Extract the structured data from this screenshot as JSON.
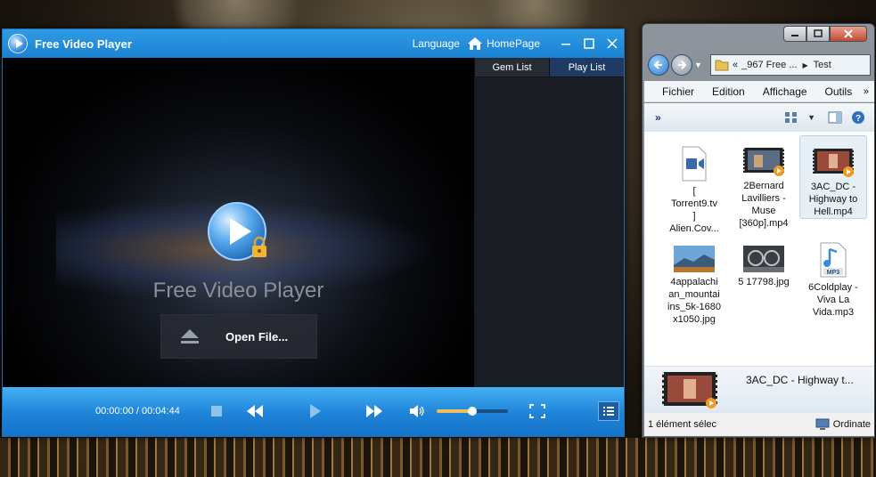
{
  "player": {
    "title": "Free Video Player",
    "language": "Language",
    "homepage": "HomePage",
    "caption": "Free Video Player",
    "open_file": "Open File...",
    "tabs": [
      "Gem List",
      "Play List"
    ],
    "active_tab": "Play List",
    "time": "00:00:00 / 00:04:44",
    "volume": 0.5,
    "accent": "#1a82d2"
  },
  "explorer": {
    "address": {
      "parent": "_967 Free ...",
      "current": "Test"
    },
    "menu": [
      "Fichier",
      "Edition",
      "Affichage",
      "Outils"
    ],
    "files": [
      {
        "name": "[ Torrent9.tv ] Alien.Cov...",
        "icon": "video-file-icon"
      },
      {
        "name": "2Bernard Lavilliers - Muse [360p].mp4",
        "icon": "video-thumb-icon"
      },
      {
        "name": "3AC_DC - Highway to Hell.mp4",
        "icon": "video-thumb-icon"
      },
      {
        "name": "4appalachian_mountains_5k-1680x1050.jpg",
        "icon": "image-thumb-icon"
      },
      {
        "name": "5 17798.jpg",
        "icon": "image-thumb-icon"
      },
      {
        "name": "6Coldplay - Viva La Vida.mp3",
        "icon": "mp3-file-icon"
      }
    ],
    "file_lines": [
      [
        "[",
        "Torrent9.tv",
        "]",
        "Alien.Cov..."
      ],
      [
        "2Bernard",
        "Lavilliers -",
        "Muse",
        "[360p].mp4"
      ],
      [
        "3AC_DC -",
        "Highway to",
        "Hell.mp4"
      ],
      [
        "4appalachi",
        "an_mountai",
        "ins_5k-1680",
        "x1050.jpg"
      ],
      [
        "5 17798.jpg"
      ],
      [
        "6Coldplay -",
        "Viva La",
        "Vida.mp3"
      ]
    ],
    "details_name": "3AC_DC - Highway t...",
    "status_left": "1 élément sélec",
    "status_right": "Ordinate"
  }
}
